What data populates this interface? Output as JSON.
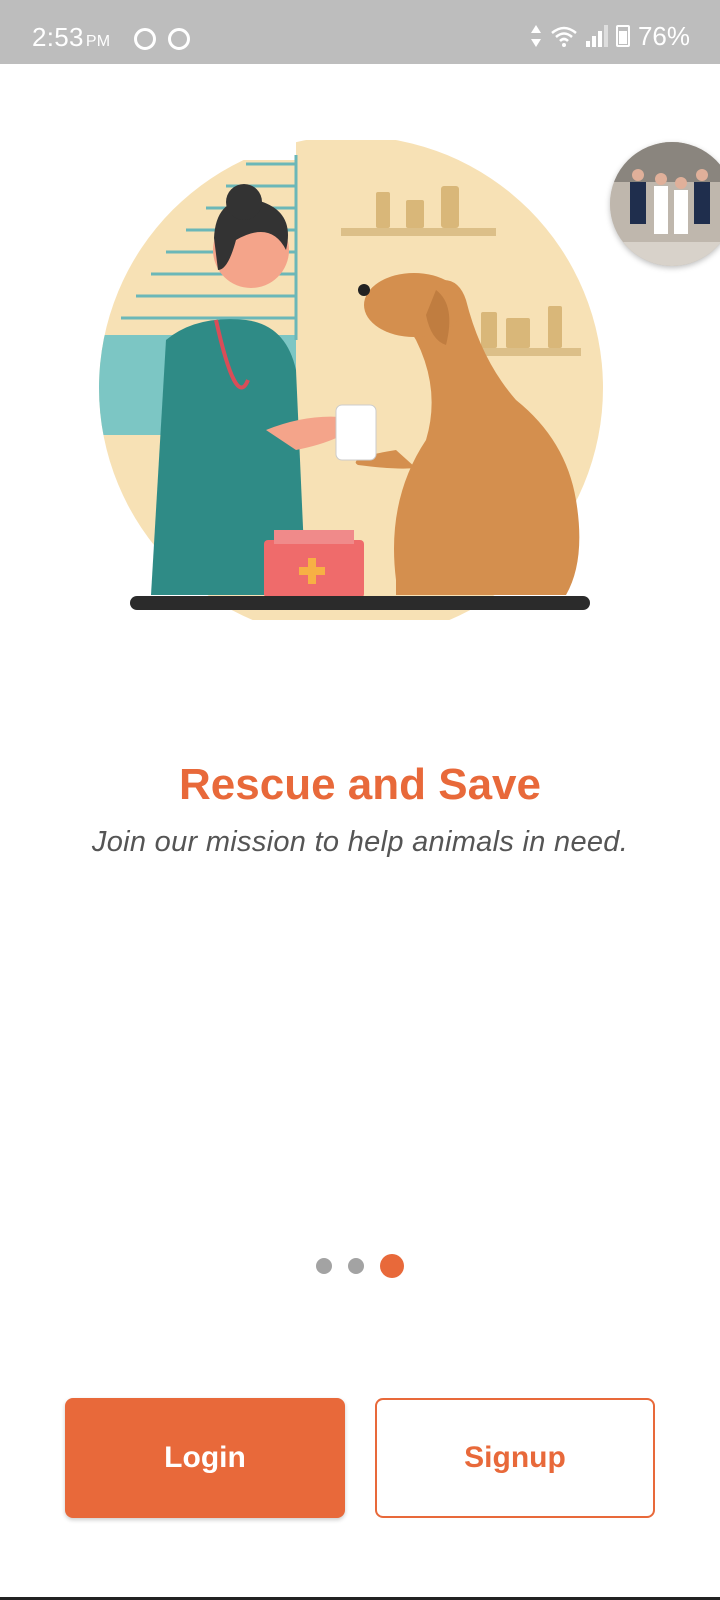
{
  "status_bar": {
    "time": "2:53",
    "ampm": "PM",
    "battery": "76%"
  },
  "onboarding": {
    "title": "Rescue and Save",
    "subtitle": "Join our mission to help animals in need.",
    "page_count": 3,
    "active_page": 3
  },
  "actions": {
    "login_label": "Login",
    "signup_label": "Signup"
  },
  "colors": {
    "accent": "#e8693a",
    "status_bar": "#bdbdbd",
    "dot_inactive": "#a3a3a3"
  },
  "icons": {
    "status_left": [
      "p-badge-icon",
      "messenger-icon"
    ],
    "status_right": [
      "data-arrows-icon",
      "wifi-icon",
      "signal-icon",
      "battery-icon"
    ]
  }
}
